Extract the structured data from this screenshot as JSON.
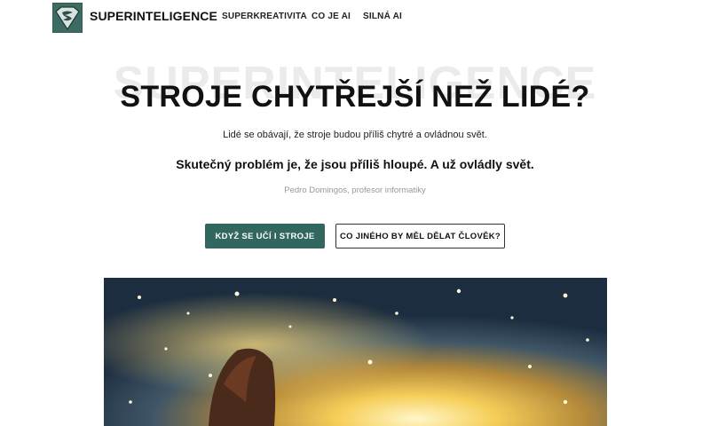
{
  "header": {
    "brand": "SUPERINTELIGENCE",
    "logo_icon": "superman-shield-icon",
    "nav": [
      "SUPERKREATIVITA",
      "CO JE AI",
      "SILNÁ AI"
    ]
  },
  "hero": {
    "ghost_text": "SUPERINTELIGENCE",
    "headline": "STROJE CHYTŘEJŠÍ NEŽ LIDÉ?",
    "subtitle": "Lidé se obávají, že stroje budou příliš chytré a ovládnou svět.",
    "quote": "Skutečný problém je, že jsou příliš hloupé. A už ovládly svět.",
    "author": "Pedro Domingos, profesor informatiky"
  },
  "buttons": {
    "primary": "KDYŽ SE UČÍ I STROJE",
    "secondary": "CO JINÉHO BY MĚL DĚLAT ČLOVĚK?"
  },
  "colors": {
    "accent": "#31675f"
  }
}
